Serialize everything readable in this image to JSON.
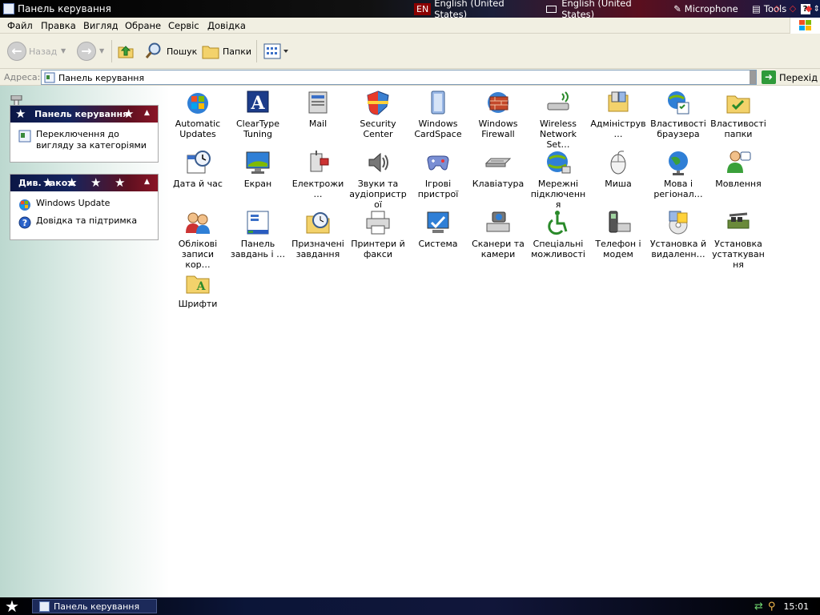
{
  "window": {
    "title": "Панель керування",
    "langbar": {
      "lang_code": "EN",
      "lang_name": "English (United States)",
      "keyboard": "English (United States)",
      "microphone": "Microphone",
      "tools": "Tools",
      "help": "?"
    }
  },
  "menu": [
    "Файл",
    "Правка",
    "Вигляд",
    "Обране",
    "Сервіс",
    "Довідка"
  ],
  "toolbar": {
    "back_label": "Назад",
    "search_label": "Пошук",
    "folders_label": "Папки"
  },
  "address": {
    "label": "Адреса:",
    "value": "Панель керування",
    "go_label": "Перехід"
  },
  "taskpane": {
    "panel1": {
      "title": "Панель керування",
      "links": [
        "Переключення до вигляду за категоріями"
      ]
    },
    "panel2": {
      "title": "Див. також",
      "links": [
        "Windows Update",
        "Довідка та підтримка"
      ]
    }
  },
  "icons": [
    {
      "label": "Automatic Updates",
      "icon": "automatic-updates-icon"
    },
    {
      "label": "ClearType Tuning",
      "icon": "cleartype-icon"
    },
    {
      "label": "Mail",
      "icon": "mail-icon"
    },
    {
      "label": "Security Center",
      "icon": "security-shield-icon"
    },
    {
      "label": "Windows CardSpace",
      "icon": "cardspace-icon"
    },
    {
      "label": "Windows Firewall",
      "icon": "firewall-icon"
    },
    {
      "label": "Wireless Network Set…",
      "icon": "wireless-icon"
    },
    {
      "label": "Адмініструв…",
      "icon": "admin-tools-icon"
    },
    {
      "label": "Властивості браузера",
      "icon": "browser-options-icon"
    },
    {
      "label": "Властивості папки",
      "icon": "folder-options-icon"
    },
    {
      "label": "Дата й час",
      "icon": "date-time-icon"
    },
    {
      "label": "Екран",
      "icon": "display-icon"
    },
    {
      "label": "Електрожи…",
      "icon": "power-icon"
    },
    {
      "label": "Звуки та аудіопристрої",
      "icon": "sound-icon"
    },
    {
      "label": "Ігрові пристрої",
      "icon": "game-controller-icon"
    },
    {
      "label": "Клавіатура",
      "icon": "keyboard-icon"
    },
    {
      "label": "Мережні підключення",
      "icon": "network-icon"
    },
    {
      "label": "Миша",
      "icon": "mouse-icon"
    },
    {
      "label": "Мова і регіонал…",
      "icon": "region-globe-icon"
    },
    {
      "label": "Мовлення",
      "icon": "speech-icon"
    },
    {
      "label": "Облікові записи кор…",
      "icon": "user-accounts-icon"
    },
    {
      "label": "Панель завдань і …",
      "icon": "taskbar-icon"
    },
    {
      "label": "Призначені завдання",
      "icon": "scheduled-tasks-icon"
    },
    {
      "label": "Принтери й факси",
      "icon": "printer-icon"
    },
    {
      "label": "Система",
      "icon": "system-icon"
    },
    {
      "label": "Сканери та камери",
      "icon": "scanner-camera-icon"
    },
    {
      "label": "Спеціальні можливості",
      "icon": "accessibility-icon"
    },
    {
      "label": "Телефон і модем",
      "icon": "phone-modem-icon"
    },
    {
      "label": "Установка й видаленн…",
      "icon": "add-remove-icon"
    },
    {
      "label": "Установка устаткування",
      "icon": "add-hardware-icon"
    },
    {
      "label": "Шрифти",
      "icon": "fonts-icon"
    }
  ],
  "taskbar": {
    "task_label": "Панель керування",
    "clock": "15:01"
  },
  "colors": {
    "accent_navy": "#0b1746",
    "accent_red": "#8a1526",
    "go_green": "#2f9a3a"
  }
}
